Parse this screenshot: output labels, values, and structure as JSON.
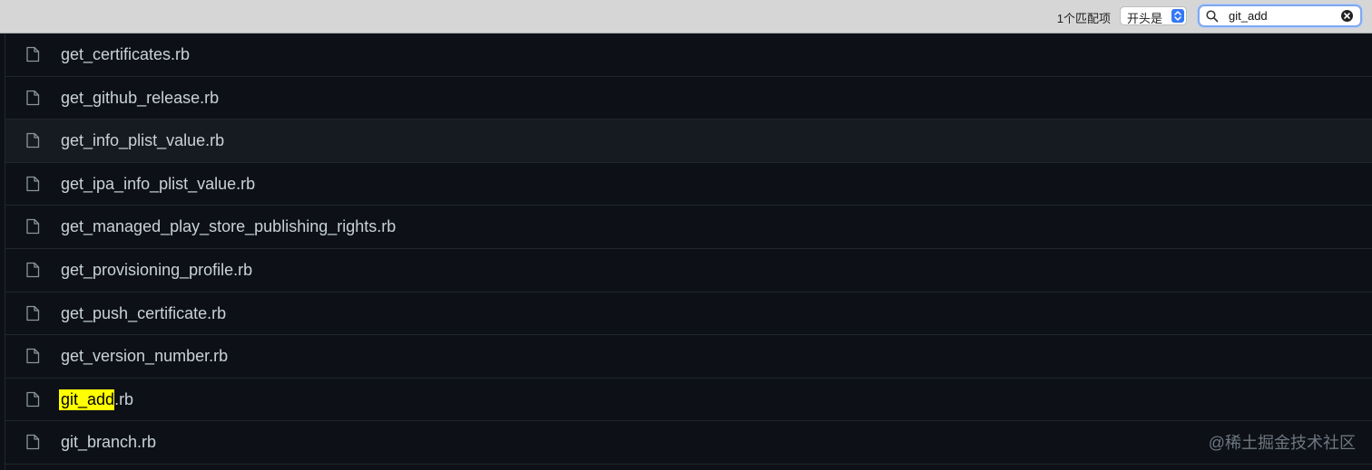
{
  "findbar": {
    "match_count": "1个匹配项",
    "mode_label": "开头是",
    "search_value": "git_add",
    "colors": {
      "accent": "#3478f6",
      "highlight": "#ffff00"
    }
  },
  "files": [
    {
      "name": "get_certificates.rb",
      "icon": "file-icon"
    },
    {
      "name": "get_github_release.rb",
      "icon": "file-icon"
    },
    {
      "name": "get_info_plist_value.rb",
      "icon": "file-icon"
    },
    {
      "name": "get_ipa_info_plist_value.rb",
      "icon": "file-icon"
    },
    {
      "name": "get_managed_play_store_publishing_rights.rb",
      "icon": "file-icon"
    },
    {
      "name": "get_provisioning_profile.rb",
      "icon": "file-icon"
    },
    {
      "name": "get_push_certificate.rb",
      "icon": "file-icon"
    },
    {
      "name": "get_version_number.rb",
      "icon": "file-icon"
    },
    {
      "name_match": "git_add",
      "name_rest": ".rb",
      "icon": "file-icon"
    },
    {
      "name": "git_branch.rb",
      "icon": "file-icon"
    }
  ],
  "watermark": "@稀土掘金技术社区"
}
